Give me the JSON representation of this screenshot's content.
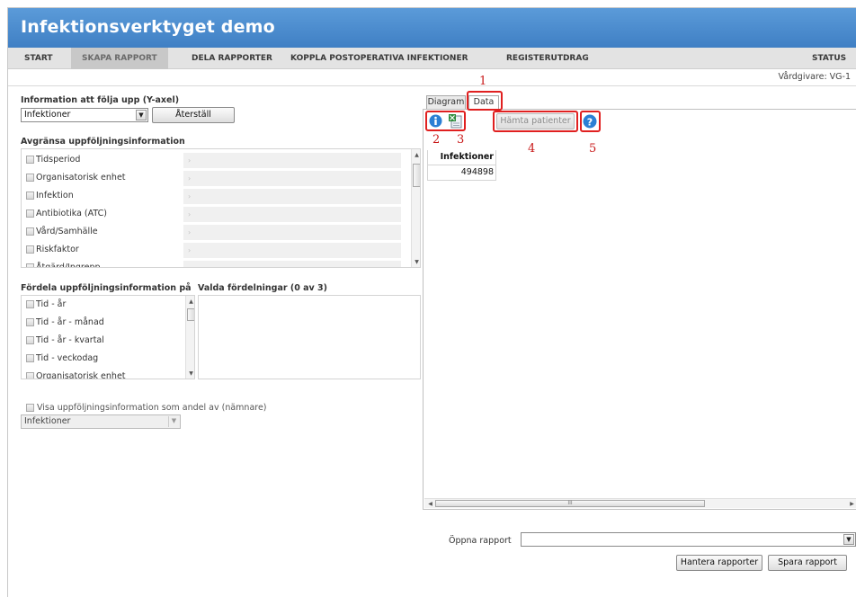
{
  "app": {
    "title": "Infektionsverktyget demo"
  },
  "nav": [
    {
      "label": "START"
    },
    {
      "label": "SKAPA RAPPORT"
    },
    {
      "label": "DELA RAPPORTER"
    },
    {
      "label": "KOPPLA POSTOPERATIVA INFEKTIONER"
    },
    {
      "label": "REGISTERUTDRAG"
    },
    {
      "label": "STATUS"
    }
  ],
  "provider": "Vårdgivare: VG-1",
  "left": {
    "yaxis_label": "Information att följa upp (Y-axel)",
    "yaxis_value": "Infektioner",
    "reset_label": "Återställ",
    "limit_label": "Avgränsa uppföljningsinformation",
    "limit_items": [
      "Tidsperiod",
      "Organisatorisk enhet",
      "Infektion",
      "Antibiotika (ATC)",
      "Vård/Samhälle",
      "Riskfaktor",
      "Åtgärd/Ingrepp"
    ],
    "distribute_label": "Fördela uppföljningsinformation på",
    "chosen_label": "Valda fördelningar (0 av 3)",
    "distribute_items": [
      "Tid - år",
      "Tid - år - månad",
      "Tid - år - kvartal",
      "Tid - veckodag",
      "Organisatorisk enhet"
    ],
    "share_label": "Visa uppföljningsinformation som andel av (nämnare)",
    "share_value": "Infektioner"
  },
  "right": {
    "tabs": [
      {
        "label": "Diagram"
      },
      {
        "label": "Data"
      }
    ],
    "fetch_label": "Hämta patienter",
    "table_header": "Infektioner",
    "table_value": "494898",
    "callouts": [
      "1",
      "2",
      "3",
      "4",
      "5"
    ],
    "hscroll_grip": "III"
  },
  "bottom": {
    "open_label": "Öppna rapport",
    "open_value": "",
    "manage_label": "Hantera rapporter",
    "save_label": "Spara rapport"
  },
  "colors": {
    "header": "#4a8ad0",
    "callout": "#e02020",
    "info": "#2b7fd4"
  }
}
